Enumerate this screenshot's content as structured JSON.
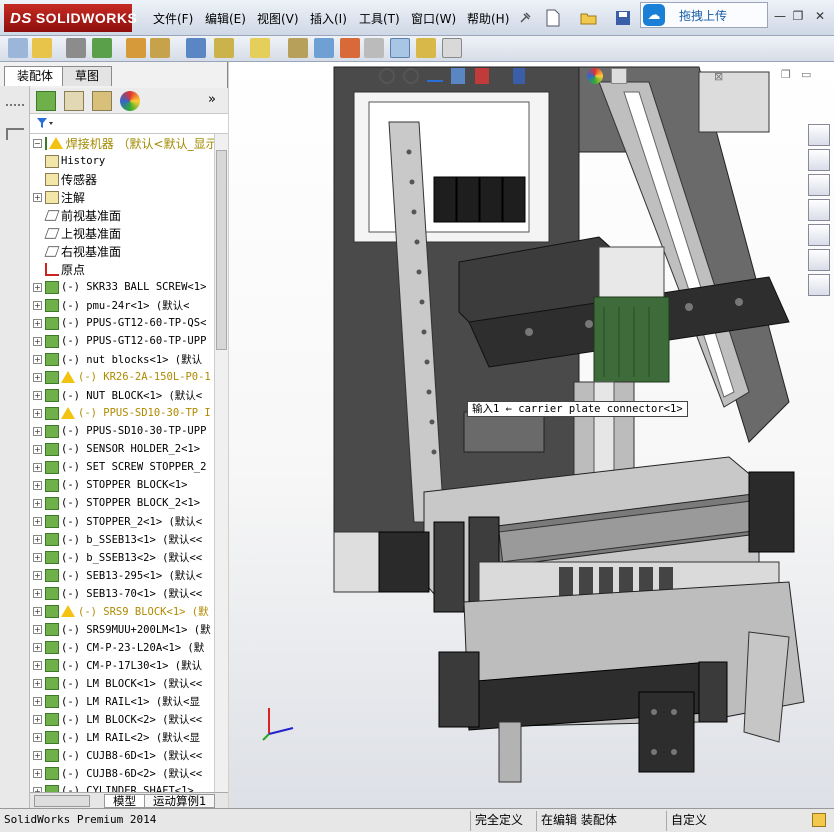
{
  "app": {
    "logo_text": "SOLIDWORKS",
    "logo_prefix": "DS",
    "accent_red": "#c62a23"
  },
  "menu": [
    "文件(F)",
    "编辑(E)",
    "视图(V)",
    "插入(I)",
    "工具(T)",
    "窗口(W)",
    "帮助(H)"
  ],
  "upload": {
    "label": "拖拽上传",
    "icon": "cloud-upload-icon"
  },
  "panel_tabs": [
    "装配体",
    "草图"
  ],
  "tree": {
    "root": "焊接机器 （默认<默认_显示",
    "rows": [
      {
        "label": "History",
        "icon": "history-icon",
        "expand": false,
        "mono": true
      },
      {
        "label": "传感器",
        "icon": "sensor-icon",
        "expand": false,
        "mono": false
      },
      {
        "label": "注解",
        "icon": "annotation-icon",
        "expand": true,
        "mono": false
      },
      {
        "label": "前视基准面",
        "icon": "plane-icon",
        "expand": false,
        "mono": false
      },
      {
        "label": "上视基准面",
        "icon": "plane-icon",
        "expand": false,
        "mono": false
      },
      {
        "label": "右视基准面",
        "icon": "plane-icon",
        "expand": false,
        "mono": false
      },
      {
        "label": "原点",
        "icon": "origin-icon",
        "expand": false,
        "mono": false
      },
      {
        "label": "(-) SKR33 BALL SCREW<1>",
        "icon": "part-icon",
        "expand": true,
        "mono": true
      },
      {
        "label": "(-) pmu-24r<1> (默认<",
        "icon": "part-icon",
        "expand": true,
        "mono": true
      },
      {
        "label": "(-) PPUS-GT12-60-TP-QS<",
        "icon": "part-icon",
        "expand": true,
        "mono": true
      },
      {
        "label": "(-) PPUS-GT12-60-TP-UPP",
        "icon": "part-icon",
        "expand": true,
        "mono": true
      },
      {
        "label": "(-) nut blocks<1> (默认",
        "icon": "part-icon",
        "expand": true,
        "mono": true
      },
      {
        "label": "(-) KR26-2A-150L-P0-1",
        "icon": "part-icon",
        "expand": true,
        "mono": true,
        "warn": true
      },
      {
        "label": "(-) NUT BLOCK<1> (默认<",
        "icon": "part-icon",
        "expand": true,
        "mono": true
      },
      {
        "label": "(-) PPUS-SD10-30-TP I",
        "icon": "part-icon",
        "expand": true,
        "mono": true,
        "warn": true
      },
      {
        "label": "(-) PPUS-SD10-30-TP-UPP",
        "icon": "part-icon",
        "expand": true,
        "mono": true
      },
      {
        "label": "(-) SENSOR HOLDER_2<1>",
        "icon": "part-icon",
        "expand": true,
        "mono": true
      },
      {
        "label": "(-) SET SCREW STOPPER_2",
        "icon": "part-icon",
        "expand": true,
        "mono": true
      },
      {
        "label": "(-) STOPPER BLOCK<1>",
        "icon": "part-icon",
        "expand": true,
        "mono": true
      },
      {
        "label": "(-) STOPPER BLOCK_2<1>",
        "icon": "part-icon",
        "expand": true,
        "mono": true
      },
      {
        "label": "(-) STOPPER_2<1> (默认<",
        "icon": "part-icon",
        "expand": true,
        "mono": true
      },
      {
        "label": "(-) b_SSEB13<1> (默认<<",
        "icon": "part-icon",
        "expand": true,
        "mono": true
      },
      {
        "label": "(-) b_SSEB13<2> (默认<<",
        "icon": "part-icon",
        "expand": true,
        "mono": true
      },
      {
        "label": "(-) SEB13-295<1> (默认<",
        "icon": "part-icon",
        "expand": true,
        "mono": true
      },
      {
        "label": "(-) SEB13-70<1> (默认<<",
        "icon": "part-icon",
        "expand": true,
        "mono": true
      },
      {
        "label": "(-) SRS9 BLOCK<1> (默",
        "icon": "part-icon",
        "expand": true,
        "mono": true,
        "warn": true
      },
      {
        "label": "(-) SRS9MUU+200LM<1> (默",
        "icon": "part-icon",
        "expand": true,
        "mono": true
      },
      {
        "label": "(-) CM-P-23-L20A<1> (默",
        "icon": "part-icon",
        "expand": true,
        "mono": true
      },
      {
        "label": "(-) CM-P-17L30<1> (默认",
        "icon": "part-icon",
        "expand": true,
        "mono": true
      },
      {
        "label": "(-) LM BLOCK<1> (默认<<",
        "icon": "part-icon",
        "expand": true,
        "mono": true
      },
      {
        "label": "(-) LM RAIL<1> (默认<显",
        "icon": "part-icon",
        "expand": true,
        "mono": true
      },
      {
        "label": "(-) LM BLOCK<2> (默认<<",
        "icon": "part-icon",
        "expand": true,
        "mono": true
      },
      {
        "label": "(-) LM RAIL<2> (默认<显",
        "icon": "part-icon",
        "expand": true,
        "mono": true
      },
      {
        "label": "(-) CUJB8-6D<1> (默认<<",
        "icon": "part-icon",
        "expand": true,
        "mono": true
      },
      {
        "label": "(-) CUJB8-6D<2> (默认<<",
        "icon": "part-icon",
        "expand": true,
        "mono": true
      },
      {
        "label": "(-) CYLINDER SHAFT<1>",
        "icon": "part-icon",
        "expand": true,
        "mono": true
      }
    ]
  },
  "bottom_tabs": [
    "模型",
    "运动算例1"
  ],
  "tooltip": "输入1 ← carrier plate connector<1>",
  "status": {
    "app": "SolidWorks Premium 2014",
    "cells": [
      "完全定义",
      "在编辑 装配体",
      "自定义"
    ]
  },
  "colors": {
    "viewport_bg": "#ffffff",
    "frame_dark": "#3a3a3a",
    "motor_green": "#3e6b3a",
    "bracket_orange": "#d9822b"
  }
}
